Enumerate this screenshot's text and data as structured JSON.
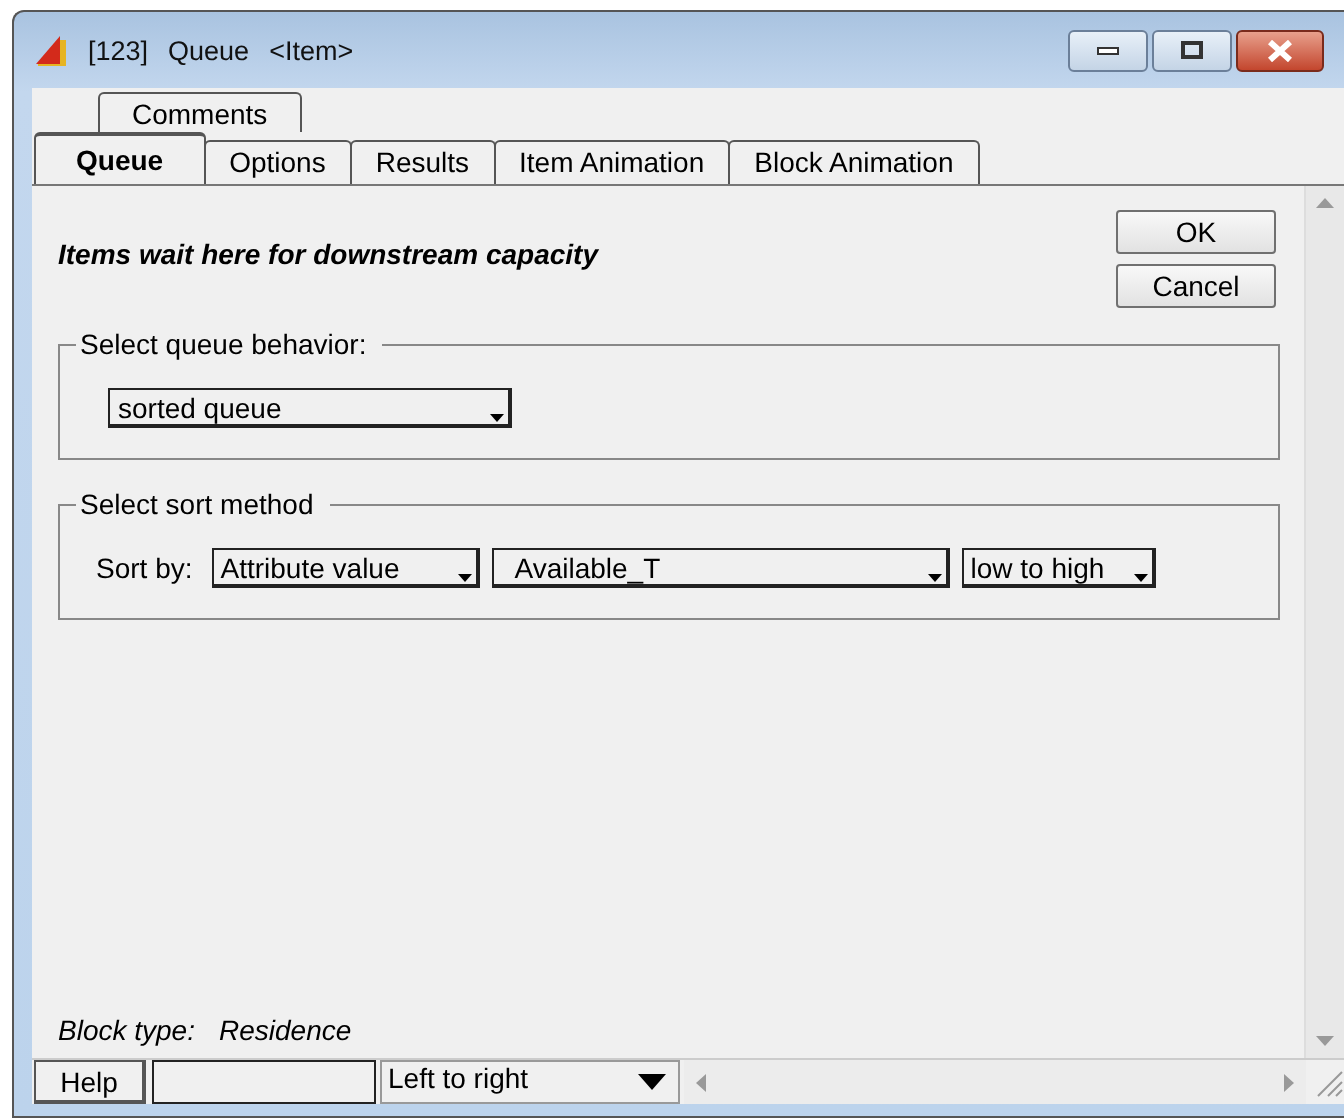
{
  "window": {
    "title_parts": [
      "[123]",
      "Queue",
      "<Item>"
    ]
  },
  "tabs_back_row": [
    {
      "label": "Comments",
      "selected": false
    }
  ],
  "tabs": [
    {
      "label": "Queue",
      "selected": true
    },
    {
      "label": "Options",
      "selected": false
    },
    {
      "label": "Results",
      "selected": false
    },
    {
      "label": "Item Animation",
      "selected": false
    },
    {
      "label": "Block Animation",
      "selected": false
    }
  ],
  "description": "Items wait here for downstream capacity",
  "buttons": [
    "OK",
    "Cancel"
  ],
  "queue_behavior": {
    "legend": "Select queue behavior:",
    "value": "sorted queue"
  },
  "sort_method": {
    "legend": "Select sort method",
    "label": "Sort by:",
    "dropdowns": [
      "Attribute value",
      "Available_T",
      "low to high"
    ]
  },
  "block_type": {
    "label": "Block type:",
    "value": "Residence"
  },
  "status_bar": {
    "help": "Help",
    "direction": "Left to right"
  }
}
